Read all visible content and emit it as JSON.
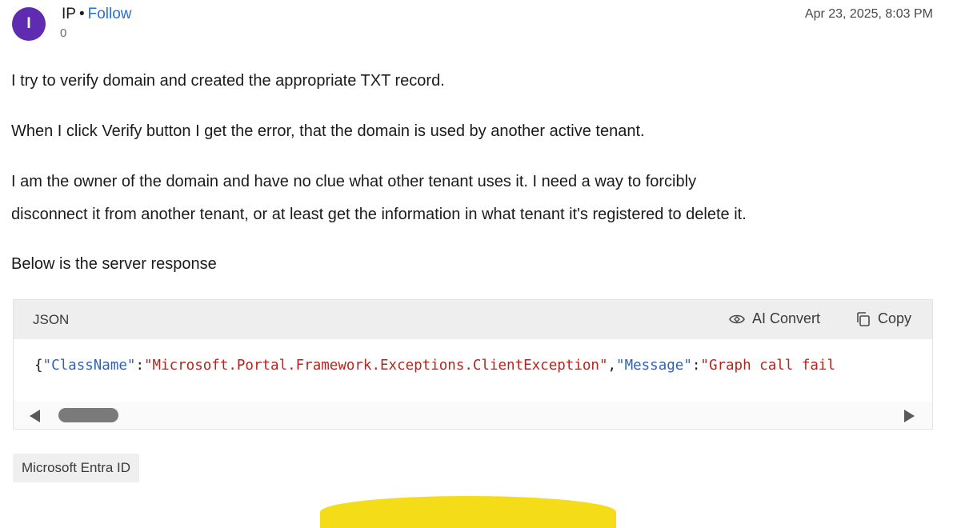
{
  "post": {
    "avatar_initial": "I",
    "author": "IP",
    "separator": "•",
    "follow_label": "Follow",
    "count": "0",
    "timestamp": "Apr 23, 2025, 8:03 PM",
    "paragraphs": [
      "I try to verify domain and created the appropriate TXT record.",
      "When I click Verify button I get the error, that the domain is used by another active tenant.",
      "I am the owner of the domain and have no clue what other tenant uses it. I need a way to forcibly",
      "disconnect it from another tenant, or at least get the information in what tenant it's registered to delete it.",
      "Below is the server response"
    ],
    "tag": "Microsoft Entra ID"
  },
  "code": {
    "language": "JSON",
    "ai_convert_label": "AI Convert",
    "copy_label": "Copy",
    "tokens": {
      "t0": "{",
      "t1": "\"ClassName\"",
      "t2": ":",
      "t3": "\"Microsoft.Portal.Framework.Exceptions.ClientException\"",
      "t4": ",",
      "t5": "\"Message\"",
      "t6": ":",
      "t7": "\"Graph call fail"
    }
  },
  "colors": {
    "avatar": "#5f2bb0",
    "link": "#2b6fd1",
    "json_key": "#2e63b8",
    "json_string": "#b3261e",
    "accent_yellow": "#f4dc19"
  },
  "icons": {
    "ai_convert": "ai-convert-icon",
    "copy": "copy-icon",
    "scroll_left": "scroll-left-arrow-icon",
    "scroll_right": "scroll-right-arrow-icon"
  }
}
